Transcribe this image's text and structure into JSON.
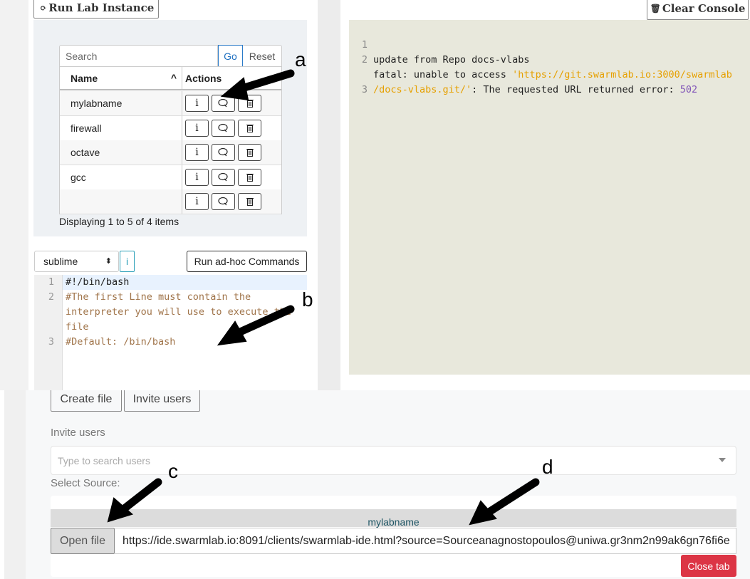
{
  "lab": {
    "run_lab_label": "Run Lab Instance",
    "run_lab_icon": "refresh-icon",
    "search_placeholder": "Search",
    "go_label": "Go",
    "reset_label": "Reset",
    "columns": {
      "name": "Name",
      "actions": "Actions"
    },
    "sort_icon": "caret-up-icon",
    "rows": [
      {
        "name": "mylabname"
      },
      {
        "name": "firewall"
      },
      {
        "name": "octave"
      },
      {
        "name": "gcc"
      },
      {
        "name": ""
      }
    ],
    "action_info_label": "i",
    "action_icons": [
      "info-icon",
      "ssh-key-icon",
      "trash-icon"
    ],
    "displaying": "Displaying 1 to 5 of 4 items"
  },
  "editor": {
    "select_value": "sublime",
    "info_label": "i",
    "adhoc_label": "Run ad-hoc Commands",
    "lines": [
      {
        "num": "1",
        "text": "#!/bin/bash"
      },
      {
        "num": "2",
        "text": "#The first Line must contain the"
      },
      {
        "num": "",
        "text": "interpreter you will use to execute the"
      },
      {
        "num": "",
        "text": "file"
      },
      {
        "num": "3",
        "text": "#Default: /bin/bash"
      }
    ],
    "comment_color": "#a0744a"
  },
  "console": {
    "clear_label": "Clear Console",
    "clear_icon": "trash-icon",
    "lines": [
      {
        "num": "1",
        "text": "update from Repo docs-vlabs"
      },
      {
        "num": "2",
        "pre": "fatal: unable to access ",
        "str": "'https://git.swarmlab.io:3000/swarmlab"
      },
      {
        "num": "",
        "str": "/docs-vlabs.git/'",
        "post": ": The requested URL returned error: ",
        "val": "502"
      },
      {
        "num": "3",
        "text": ""
      }
    ]
  },
  "ide": {
    "create_file_label": "Create file",
    "invite_users_label": "Invite users",
    "invite_field_label": "Invite users",
    "invite_placeholder": "Type to search users",
    "select_source_label": "Select Source:",
    "source_tab": "mylabname",
    "open_file_label": "Open file",
    "url": "https://ide.swarmlab.io:8091/clients/swarmlab-ide.html?source=Sourceanagnostopoulos@uniwa.gr3nm2n99ak6gn76fi6e",
    "close_tab_label": "Close tab",
    "close_tab_color": "#dc3545"
  },
  "annotations": {
    "a": "a",
    "b": "b",
    "c": "c",
    "d": "d"
  }
}
